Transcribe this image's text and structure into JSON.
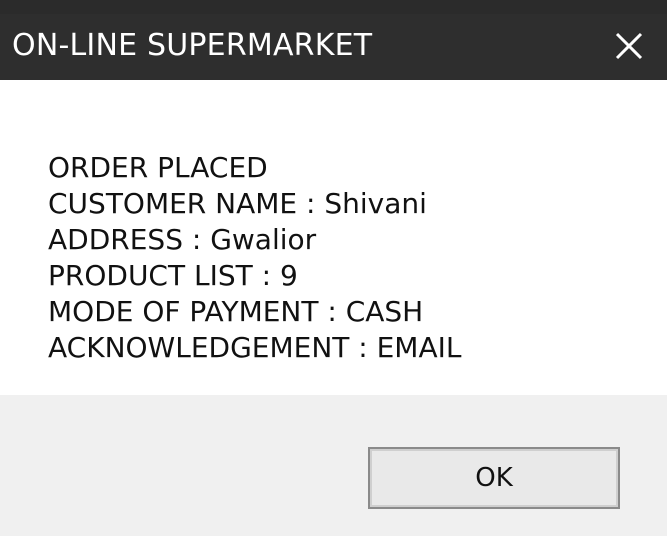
{
  "window": {
    "title": "ON-LINE SUPERMARKET",
    "close_icon": "close-icon"
  },
  "message": {
    "lines": [
      "ORDER PLACED",
      "CUSTOMER NAME : Shivani",
      "ADDRESS : Gwalior",
      "PRODUCT LIST : 9",
      "MODE OF PAYMENT : CASH",
      "ACKNOWLEDGEMENT : EMAIL"
    ]
  },
  "buttons": {
    "ok_label": "OK"
  },
  "colors": {
    "titlebar_bg": "#2e2e2e",
    "titlebar_text": "#ffffff",
    "footer_bg": "#f0f0f0"
  }
}
